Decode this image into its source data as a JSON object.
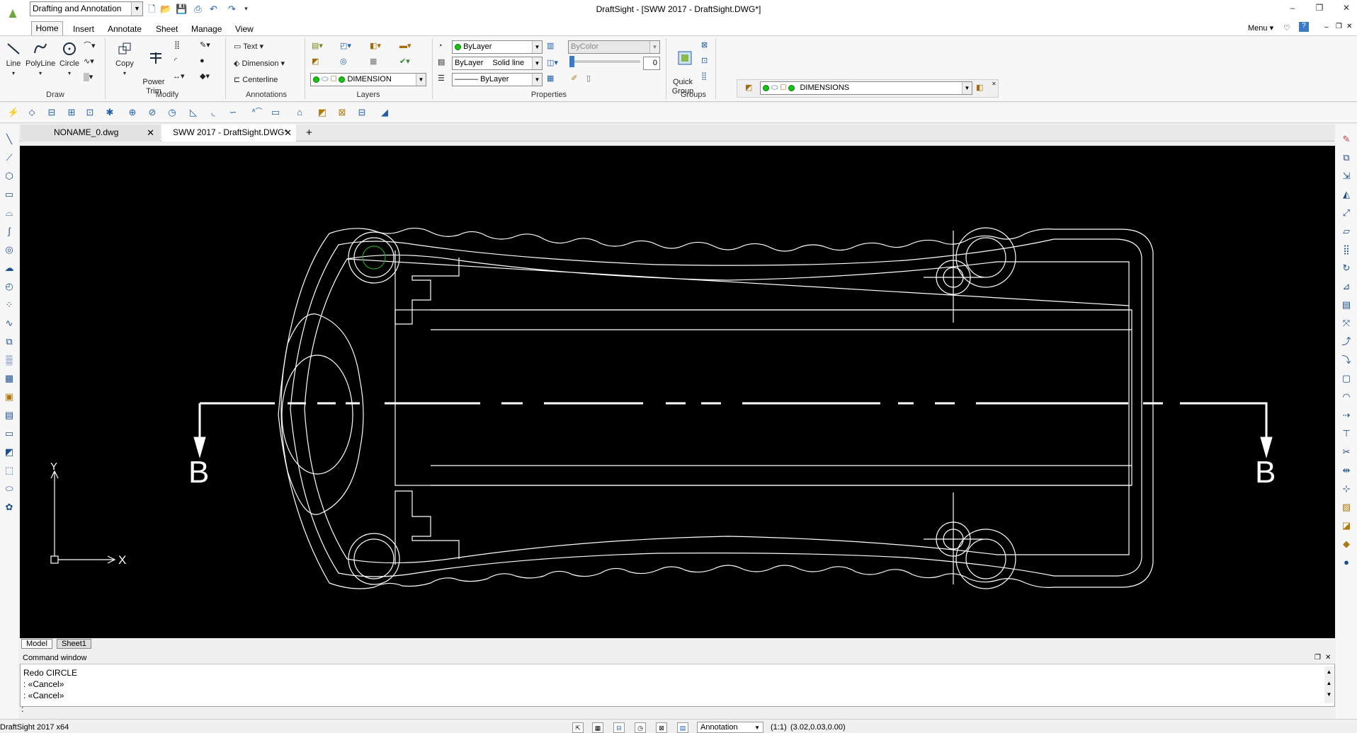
{
  "app": {
    "title": "DraftSight - [SWW 2017 - DraftSight.DWG*]",
    "workspace": "Drafting and Annotation",
    "version": "DraftSight 2017 x64",
    "menu_label": "Menu"
  },
  "menu_tabs": [
    "Home",
    "Insert",
    "Annotate",
    "Sheet",
    "Manage",
    "View"
  ],
  "ribbon": {
    "draw": {
      "label": "Draw",
      "line": "Line",
      "polyline": "PolyLine",
      "circle": "Circle"
    },
    "modify": {
      "label": "Modify",
      "copy": "Copy",
      "power_trim": "Power\nTrim"
    },
    "annotations": {
      "label": "Annotations",
      "text": "Text",
      "dimension": "Dimension",
      "centerline": "Centerline"
    },
    "layers": {
      "label": "Layers",
      "current_layer": "DIMENSION"
    },
    "properties": {
      "label": "Properties",
      "color": "ByLayer",
      "linestyle_layer": "ByLayer",
      "linestyle": "Solid line",
      "lineweight": "ByLayer",
      "plotstyle": "ByColor",
      "transparency": "0"
    },
    "groups": {
      "label": "Groups",
      "quick_group": "Quick\nGroup"
    },
    "layer_toolbar": {
      "layer": "DIMENSIONS"
    }
  },
  "documents": [
    {
      "name": "NONAME_0.dwg",
      "active": false
    },
    {
      "name": "SWW 2017 - DraftSight.DWG*",
      "active": true
    }
  ],
  "sheet_tabs": [
    "Model",
    "Sheet1"
  ],
  "command_window": {
    "title": "Command window",
    "lines": [
      "Redo CIRCLE",
      ": «Cancel»",
      ": «Cancel»",
      ":"
    ]
  },
  "status": {
    "annotation": "Annotation",
    "scale": "(1:1)",
    "coords": "(3.02,0.03,0.00)"
  },
  "drawing": {
    "section_label_left": "B",
    "section_label_right": "B",
    "ucs_x": "X",
    "ucs_y": "Y"
  },
  "colors": {
    "canvas": "#000000",
    "geometry": "#ffffff",
    "highlight_circle": "#1fa01f"
  }
}
